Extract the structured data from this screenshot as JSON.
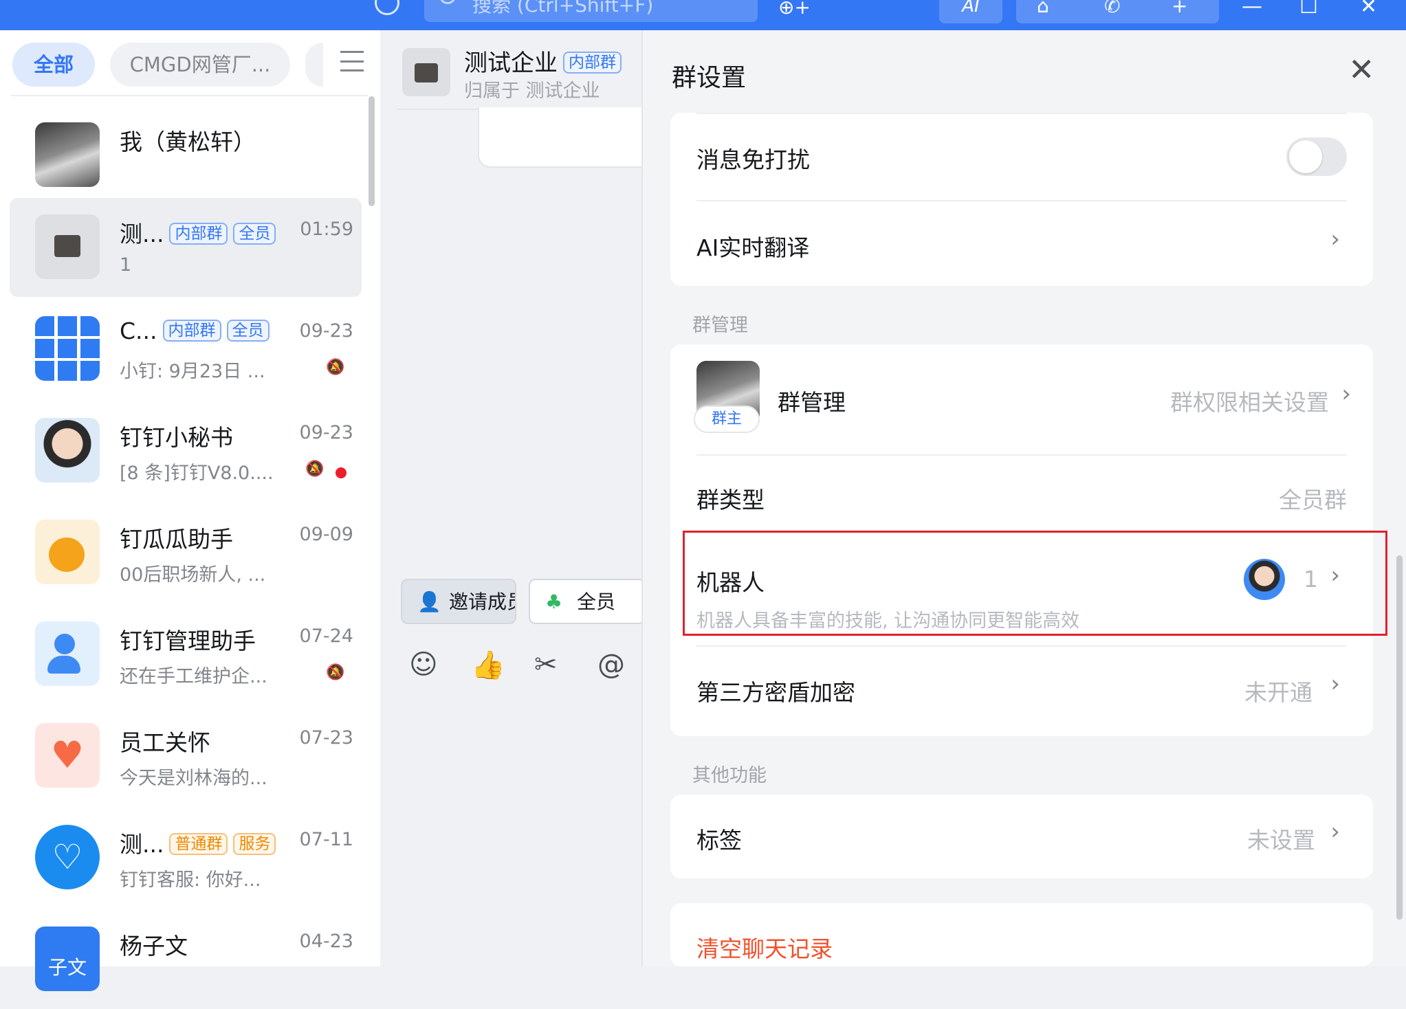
{
  "topbar": {
    "search_placeholder": "搜索 (Ctrl+Shift+F)",
    "add_friend_glyph": "⊕+",
    "ai_label": "AI",
    "icons": [
      "clock-icon",
      "search-icon",
      "add-friend-icon",
      "ai-icon",
      "screen-share-icon",
      "phone-icon",
      "plus-icon",
      "minimize-icon",
      "maximize-icon",
      "close-icon"
    ]
  },
  "filters": {
    "active": "全部",
    "second": "CMGD网管厂..."
  },
  "conversations": [
    {
      "name": "我（黄松轩）",
      "tags": [],
      "time": "",
      "preview": ""
    },
    {
      "name": "测...",
      "tags": [
        "内部群",
        "全员"
      ],
      "time": "01:59",
      "preview": "1",
      "selected": true
    },
    {
      "name": "C...",
      "tags": [
        "内部群",
        "全员"
      ],
      "time": "09-23",
      "preview": "小钉: 9月23日 ...",
      "muted": true
    },
    {
      "name": "钉钉小秘书",
      "tags": [],
      "time": "09-23",
      "preview": "[8 条]钉钉V8.0....",
      "muted": true,
      "unread": true
    },
    {
      "name": "钉瓜瓜助手",
      "tags": [],
      "time": "09-09",
      "preview": "00后职场新人, ..."
    },
    {
      "name": "钉钉管理助手",
      "tags": [],
      "time": "07-24",
      "preview": "还在手工维护企...",
      "muted": true
    },
    {
      "name": "员工关怀",
      "tags": [],
      "time": "07-23",
      "preview": "今天是刘林海的..."
    },
    {
      "name": "测...",
      "tags": [
        "普通群",
        "服务"
      ],
      "time": "07-11",
      "preview": "钉钉客服: 你好..."
    },
    {
      "name": "杨子文",
      "tags": [],
      "time": "04-23",
      "preview": "",
      "avatar_text": "子文"
    }
  ],
  "chat": {
    "title": "测试企业",
    "tag": "内部群",
    "subtitle": "归属于 测试企业",
    "invite_label": "邀请成员",
    "all_label": "全员",
    "tools": [
      "emoji-icon",
      "thumbs-up-icon",
      "scissors-icon",
      "at-icon"
    ]
  },
  "settings": {
    "title": "群设置",
    "dnd_label": "消息免打扰",
    "dnd_on": false,
    "translate_label": "AI实时翻译",
    "section_manage": "群管理",
    "manage_label": "群管理",
    "owner_badge": "群主",
    "manage_value": "群权限相关设置",
    "type_label": "群类型",
    "type_value": "全员群",
    "robot_label": "机器人",
    "robot_desc": "机器人具备丰富的技能, 让沟通协同更智能高效",
    "robot_count": "1",
    "encrypt_label": "第三方密盾加密",
    "encrypt_value": "未开通",
    "section_other": "其他功能",
    "tag_label": "标签",
    "tag_value": "未设置",
    "clear_label": "清空聊天记录",
    "chevron": "›",
    "close_glyph": "✕"
  },
  "colors": {
    "brand_blue": "#3477f5",
    "danger": "#f2512b",
    "highlight_red": "#e0212e",
    "unread_dot": "#ee1c2b"
  }
}
